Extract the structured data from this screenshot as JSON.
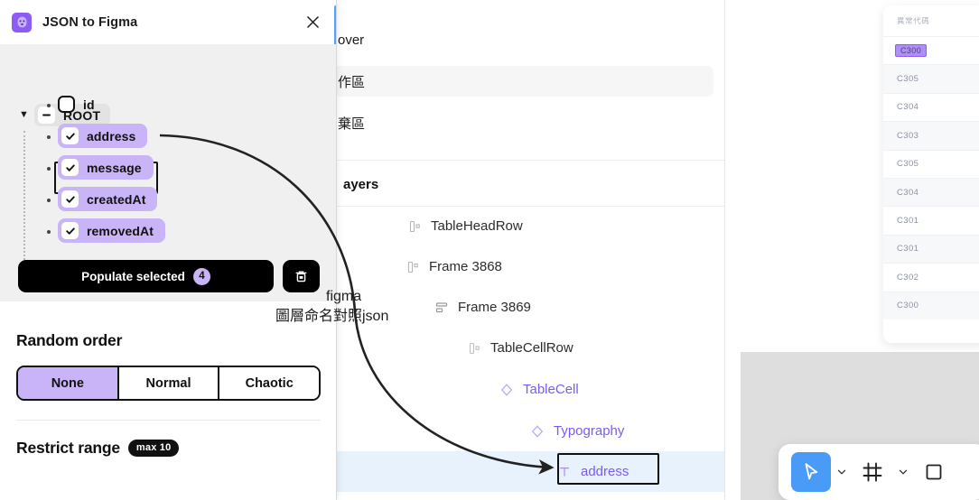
{
  "plugin": {
    "title": "JSON to Figma",
    "icon": "plugin-ghost-icon",
    "close_icon": "close-icon",
    "tree": {
      "root_label": "ROOT",
      "fields": [
        {
          "name": "id",
          "checked": false
        },
        {
          "name": "address",
          "checked": true
        },
        {
          "name": "message",
          "checked": true
        },
        {
          "name": "createdAt",
          "checked": true
        },
        {
          "name": "removedAt",
          "checked": true
        }
      ]
    },
    "populate_label": "Populate selected",
    "populate_count": "4",
    "trash_icon": "trash-icon",
    "random_order": {
      "title": "Random order",
      "options": [
        "None",
        "Normal",
        "Chaotic"
      ],
      "selected": "None"
    },
    "restrict_range": {
      "title": "Restrict range",
      "badge": "max 10"
    }
  },
  "figma_panel": {
    "rows": [
      {
        "text": "over",
        "highlight": false
      },
      {
        "text": "作區",
        "highlight": true
      },
      {
        "text": "棄區",
        "highlight": false
      }
    ],
    "layers_title": "ayers",
    "layers": [
      {
        "label": "TableHeadRow",
        "indent": 0,
        "icon": "frame-icon",
        "type": "frame"
      },
      {
        "label": "Frame 3868",
        "indent": -1,
        "icon": "frame-icon",
        "type": "frame"
      },
      {
        "label": "Frame 3869",
        "indent": 1,
        "icon": "autolayout-icon",
        "type": "frame"
      },
      {
        "label": "TableCellRow",
        "indent": 2,
        "icon": "frame-icon",
        "type": "frame"
      },
      {
        "label": "TableCell",
        "indent": 3,
        "icon": "component-icon",
        "type": "component"
      },
      {
        "label": "Typography",
        "indent": 4,
        "icon": "component-icon",
        "type": "component"
      },
      {
        "label": "address",
        "indent": 5,
        "icon": "text-icon",
        "type": "text",
        "selected": true
      }
    ]
  },
  "annotation": {
    "line1": "figma",
    "line2": "圖層命名對照json"
  },
  "code_panel": {
    "header": "異常代碼",
    "rows": [
      {
        "value": "C300",
        "editing": true
      },
      {
        "value": "C305",
        "editing": false
      },
      {
        "value": "C304",
        "editing": false
      },
      {
        "value": "C303",
        "editing": false
      },
      {
        "value": "C305",
        "editing": false
      },
      {
        "value": "C304",
        "editing": false
      },
      {
        "value": "C301",
        "editing": false
      },
      {
        "value": "C301",
        "editing": false
      },
      {
        "value": "C302",
        "editing": false
      },
      {
        "value": "C300",
        "editing": false
      }
    ]
  },
  "toolbar": {
    "tools": [
      {
        "name": "move-tool",
        "icon": "cursor-icon",
        "active": true
      },
      {
        "name": "move-tool-dropdown",
        "icon": "chevron-down-icon",
        "active": false
      },
      {
        "name": "frame-tool",
        "icon": "frame-grid-icon",
        "active": false
      },
      {
        "name": "frame-tool-dropdown",
        "icon": "chevron-down-icon",
        "active": false
      },
      {
        "name": "shape-tool",
        "icon": "square-icon",
        "active": false
      }
    ]
  },
  "colors": {
    "accent_purple": "#c9b4f7",
    "component_purple": "#7b5cf0",
    "selection_blue": "#e8f2fd",
    "toolbar_blue": "#4a9bf7",
    "black": "#000000"
  }
}
